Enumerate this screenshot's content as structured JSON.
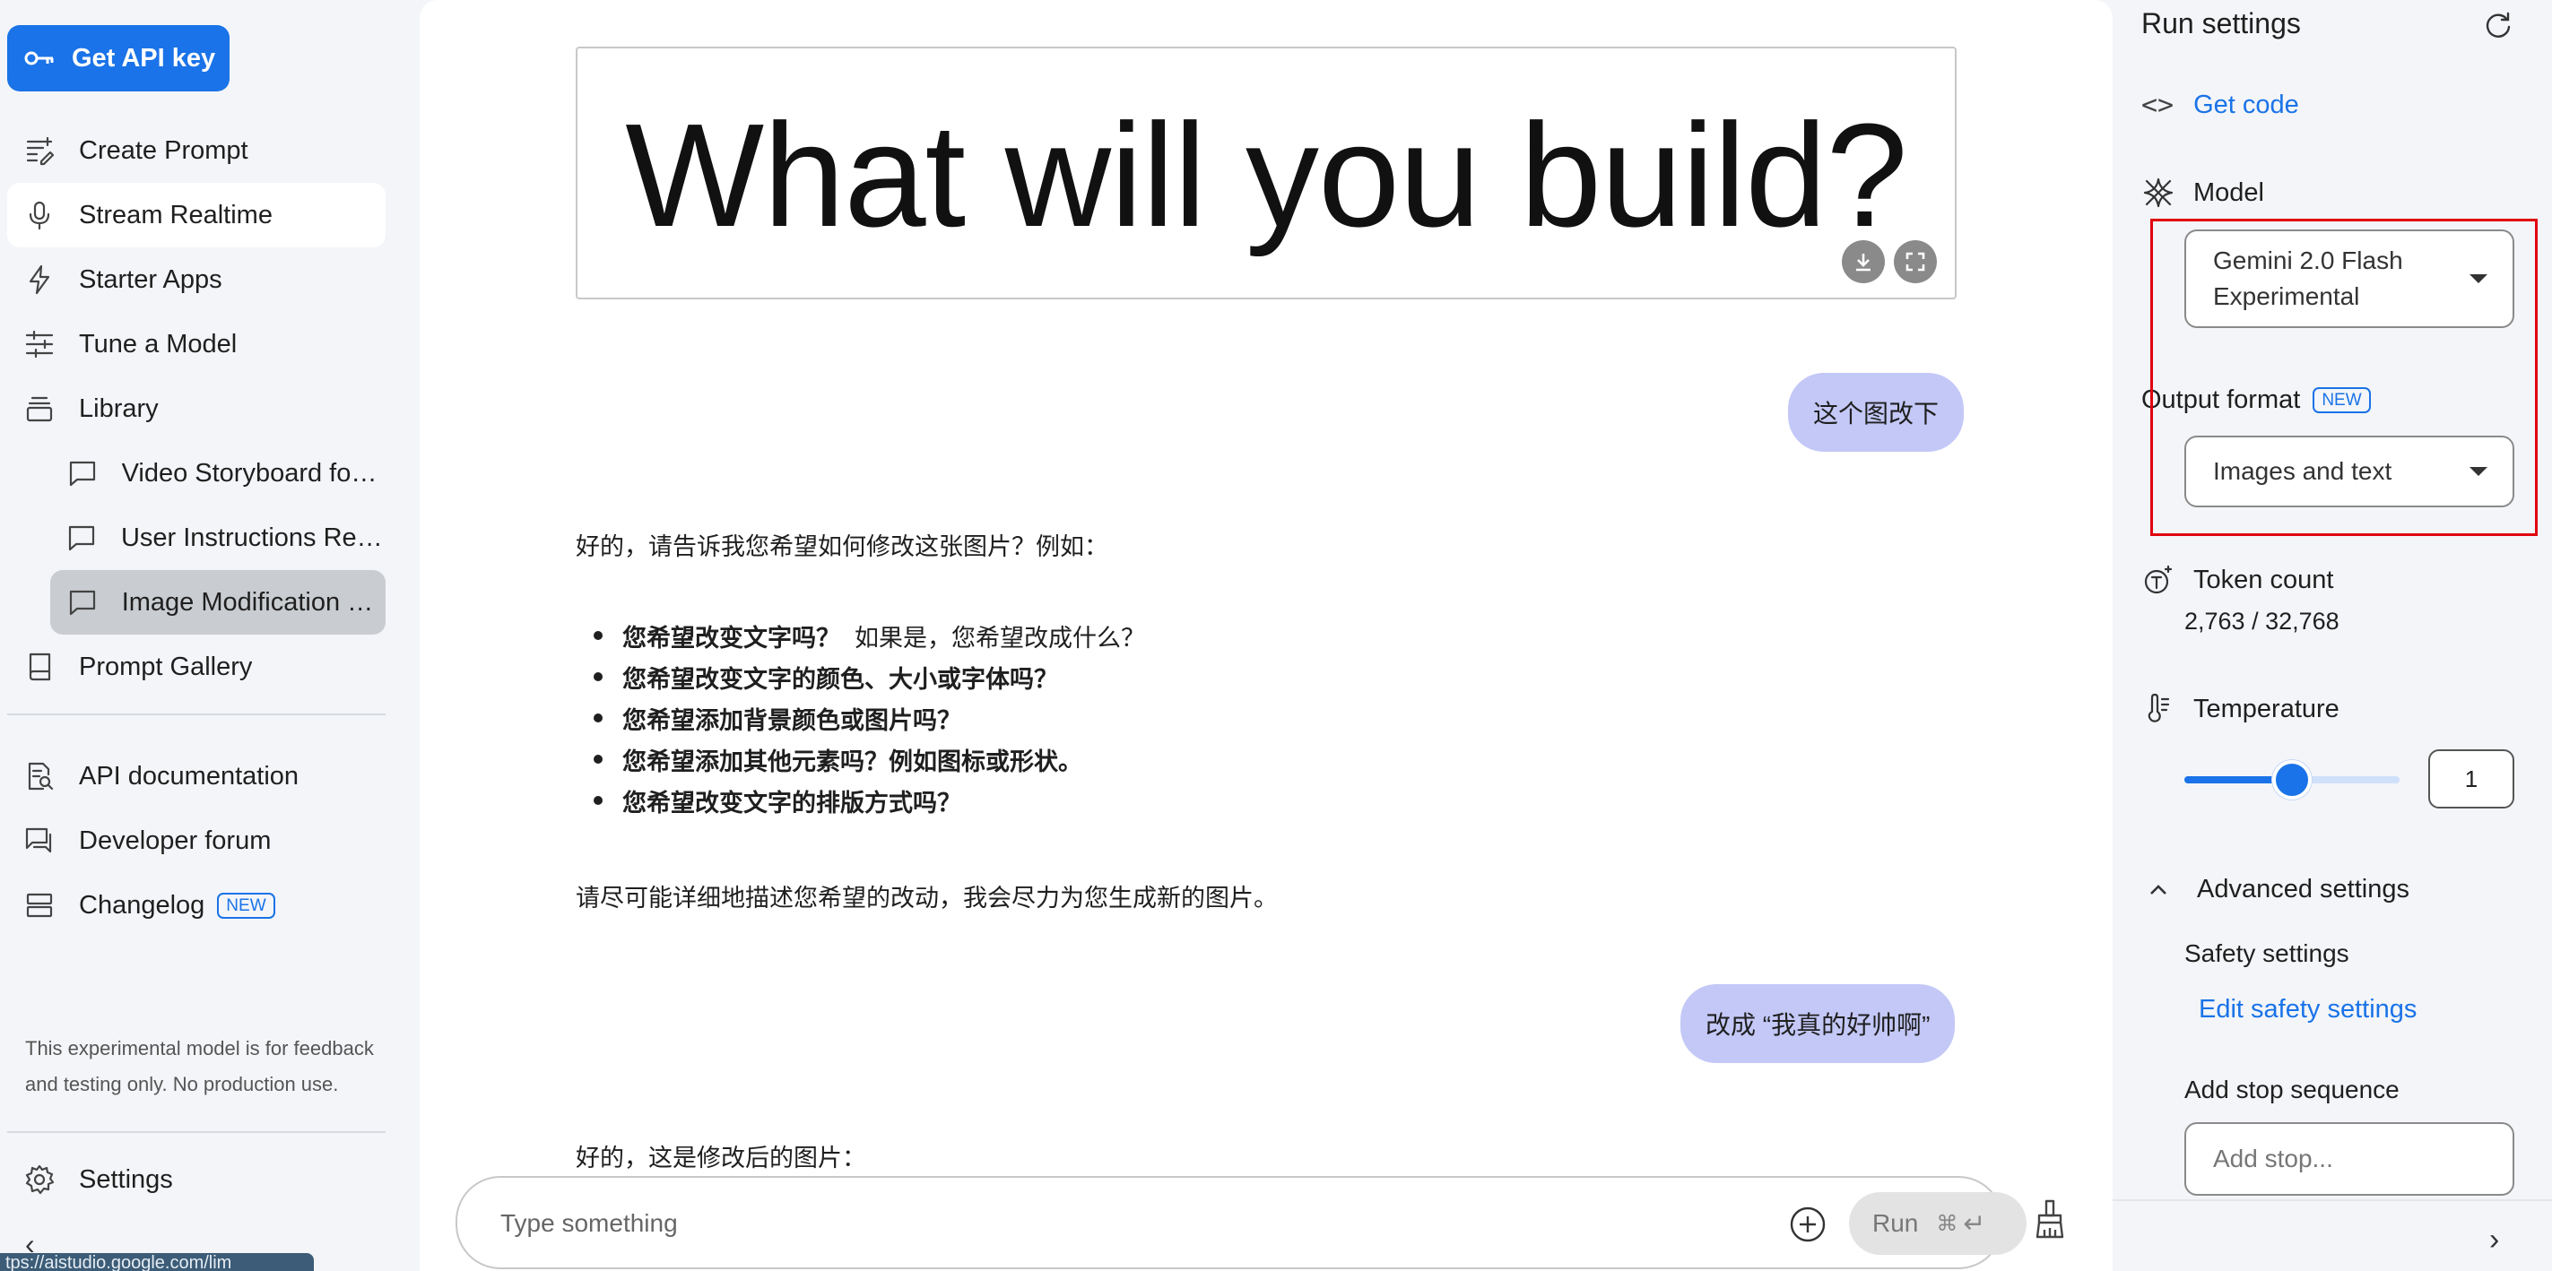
{
  "sidebar": {
    "api_key_label": "Get API key",
    "items": [
      {
        "label": "Create Prompt"
      },
      {
        "label": "Stream Realtime"
      },
      {
        "label": "Starter Apps"
      },
      {
        "label": "Tune a Model"
      },
      {
        "label": "Library"
      },
      {
        "label": "Video Storyboard for ..."
      },
      {
        "label": "User Instructions Rep..."
      },
      {
        "label": "Image Modification R..."
      },
      {
        "label": "Prompt Gallery"
      },
      {
        "label": "API documentation"
      },
      {
        "label": "Developer forum"
      },
      {
        "label": "Changelog",
        "badge": "NEW"
      }
    ],
    "footnote": "This experimental model is for feedback and testing only. No production use.",
    "settings_label": "Settings",
    "status_url": "tps://aistudio.google.com/lim"
  },
  "chat": {
    "image_text": "What will you build?",
    "user_msg_1": "这个图改下",
    "model_msg_1_intro": "好的，请告诉我您希望如何修改这张图片？例如：",
    "bullets": [
      {
        "bold": "您希望改变文字吗？",
        "rest": "如果是，您希望改成什么？"
      },
      {
        "bold": "您希望改变文字的颜色、大小或字体吗？",
        "rest": ""
      },
      {
        "bold": "您希望添加背景颜色或图片吗？",
        "rest": ""
      },
      {
        "bold": "您希望添加其他元素吗？例如图标或形状。",
        "rest": ""
      },
      {
        "bold": "您希望改变文字的排版方式吗？",
        "rest": ""
      }
    ],
    "model_msg_1_outro": "请尽可能详细地描述您希望的改动，我会尽力为您生成新的图片。",
    "user_msg_2": "改成 “我真的好帅啊”",
    "model_msg_2": "好的，这是修改后的图片：",
    "input_placeholder": "Type something",
    "run_label": "Run",
    "run_shortcut": "⌘"
  },
  "settings": {
    "title": "Run settings",
    "get_code": "Get code",
    "model_label": "Model",
    "model_value": "Gemini 2.0 Flash Experimental",
    "output_format_label": "Output format",
    "output_format_badge": "NEW",
    "output_format_value": "Images and text",
    "token_count_label": "Token count",
    "token_count_value": "2,763 / 32,768",
    "temperature_label": "Temperature",
    "temperature_value": "1",
    "temperature_fraction": 0.5,
    "advanced_label": "Advanced settings",
    "safety_label": "Safety settings",
    "edit_safety": "Edit safety settings",
    "stop_label": "Add stop sequence",
    "stop_placeholder": "Add stop..."
  },
  "colors": {
    "accent": "#1a73e8",
    "user_bubble": "#c3c8f7",
    "highlight_frame": "#e0000f"
  }
}
